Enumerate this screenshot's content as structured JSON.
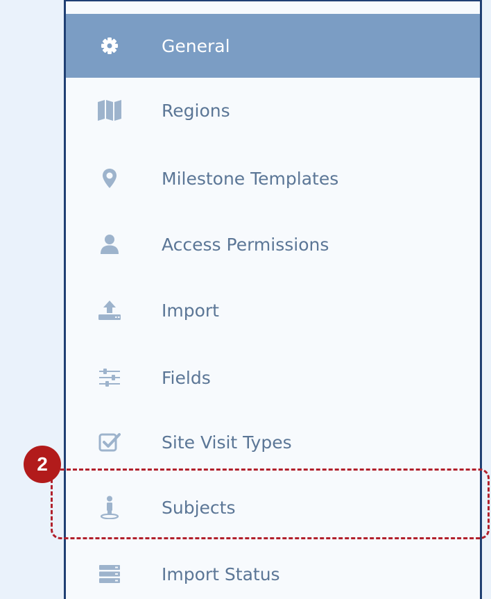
{
  "colors": {
    "active_bg": "#7b9dc4",
    "item_text": "#5b7696",
    "icon": "#9db3cc",
    "callout": "#b1202c",
    "border": "#1f3f73"
  },
  "sidebar": {
    "items": [
      {
        "label": "General",
        "icon": "gear-icon",
        "active": true
      },
      {
        "label": "Regions",
        "icon": "map-icon",
        "active": false
      },
      {
        "label": "Milestone Templates",
        "icon": "map-marker-icon",
        "active": false
      },
      {
        "label": "Access Permissions",
        "icon": "user-icon",
        "active": false
      },
      {
        "label": "Import",
        "icon": "upload-icon",
        "active": false
      },
      {
        "label": "Fields",
        "icon": "sliders-icon",
        "active": false
      },
      {
        "label": "Site Visit Types",
        "icon": "checkbox-icon",
        "active": false
      },
      {
        "label": "Subjects",
        "icon": "person-pin-icon",
        "active": false
      },
      {
        "label": "Import Status",
        "icon": "server-icon",
        "active": false
      }
    ]
  },
  "annotation": {
    "step_number": "2",
    "highlighted_item": "Subjects"
  }
}
